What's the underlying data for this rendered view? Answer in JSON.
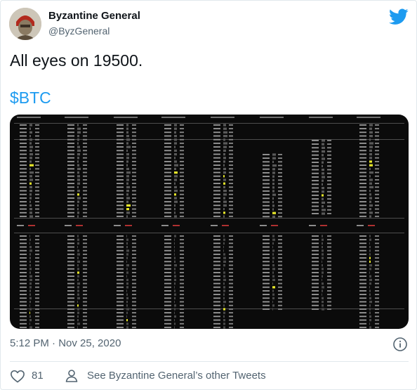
{
  "author": {
    "name": "Byzantine General",
    "handle": "@ByzGeneral"
  },
  "tweet": {
    "text": "All eyes on 19500.",
    "cashtag": "$BTC",
    "timestamp": "5:12 PM · Nov 25, 2020"
  },
  "actions": {
    "like_count": "81",
    "other_tweets_label": "See Byzantine General’s other Tweets"
  },
  "colors": {
    "brand": "#1d9bf0",
    "like": "#536471",
    "highlight": "#e6e62a"
  },
  "icons": {
    "logo": "twitter-bird-icon",
    "info": "info-icon",
    "like": "heart-icon",
    "profile": "person-icon"
  }
}
